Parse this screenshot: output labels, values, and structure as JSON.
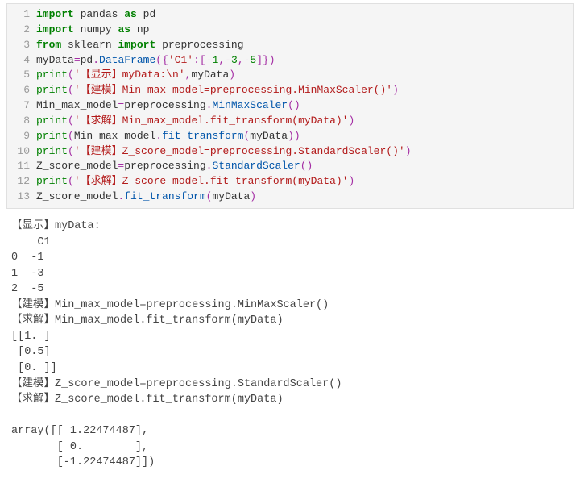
{
  "code": {
    "lines": [
      {
        "n": "1",
        "tokens": [
          [
            "kw",
            "import"
          ],
          [
            "sp",
            " "
          ],
          [
            "name",
            "pandas"
          ],
          [
            "sp",
            " "
          ],
          [
            "kw",
            "as"
          ],
          [
            "sp",
            " "
          ],
          [
            "name",
            "pd"
          ]
        ]
      },
      {
        "n": "2",
        "tokens": [
          [
            "kw",
            "import"
          ],
          [
            "sp",
            " "
          ],
          [
            "name",
            "numpy"
          ],
          [
            "sp",
            " "
          ],
          [
            "kw",
            "as"
          ],
          [
            "sp",
            " "
          ],
          [
            "name",
            "np"
          ]
        ]
      },
      {
        "n": "3",
        "tokens": [
          [
            "kw",
            "from"
          ],
          [
            "sp",
            " "
          ],
          [
            "name",
            "sklearn"
          ],
          [
            "sp",
            " "
          ],
          [
            "kw",
            "import"
          ],
          [
            "sp",
            " "
          ],
          [
            "name",
            "preprocessing"
          ]
        ]
      },
      {
        "n": "4",
        "tokens": [
          [
            "name",
            "myData"
          ],
          [
            "op",
            "="
          ],
          [
            "name",
            "pd"
          ],
          [
            "op",
            "."
          ],
          [
            "call",
            "DataFrame"
          ],
          [
            "op",
            "({"
          ],
          [
            "str",
            "'C1'"
          ],
          [
            "op",
            ":["
          ],
          [
            "op",
            "-"
          ],
          [
            "num",
            "1"
          ],
          [
            "op",
            ","
          ],
          [
            "op",
            "-"
          ],
          [
            "num",
            "3"
          ],
          [
            "op",
            ","
          ],
          [
            "op",
            "-"
          ],
          [
            "num",
            "5"
          ],
          [
            "op",
            "]})"
          ]
        ]
      },
      {
        "n": "5",
        "tokens": [
          [
            "builtin",
            "print"
          ],
          [
            "op",
            "("
          ],
          [
            "str",
            "'【显示】myData:\\n'"
          ],
          [
            "op",
            ","
          ],
          [
            "name",
            "myData"
          ],
          [
            "op",
            ")"
          ]
        ]
      },
      {
        "n": "6",
        "tokens": [
          [
            "builtin",
            "print"
          ],
          [
            "op",
            "("
          ],
          [
            "str",
            "'【建模】Min_max_model=preprocessing.MinMaxScaler()'"
          ],
          [
            "op",
            ")"
          ]
        ]
      },
      {
        "n": "7",
        "tokens": [
          [
            "name",
            "Min_max_model"
          ],
          [
            "op",
            "="
          ],
          [
            "name",
            "preprocessing"
          ],
          [
            "op",
            "."
          ],
          [
            "call",
            "MinMaxScaler"
          ],
          [
            "op",
            "()"
          ]
        ]
      },
      {
        "n": "8",
        "tokens": [
          [
            "builtin",
            "print"
          ],
          [
            "op",
            "("
          ],
          [
            "str",
            "'【求解】Min_max_model.fit_transform(myData)'"
          ],
          [
            "op",
            ")"
          ]
        ]
      },
      {
        "n": "9",
        "tokens": [
          [
            "builtin",
            "print"
          ],
          [
            "op",
            "("
          ],
          [
            "name",
            "Min_max_model"
          ],
          [
            "op",
            "."
          ],
          [
            "call",
            "fit_transform"
          ],
          [
            "op",
            "("
          ],
          [
            "name",
            "myData"
          ],
          [
            "op",
            "))"
          ]
        ]
      },
      {
        "n": "10",
        "tokens": [
          [
            "builtin",
            "print"
          ],
          [
            "op",
            "("
          ],
          [
            "str",
            "'【建模】Z_score_model=preprocessing.StandardScaler()'"
          ],
          [
            "op",
            ")"
          ]
        ]
      },
      {
        "n": "11",
        "tokens": [
          [
            "name",
            "Z_score_model"
          ],
          [
            "op",
            "="
          ],
          [
            "name",
            "preprocessing"
          ],
          [
            "op",
            "."
          ],
          [
            "call",
            "StandardScaler"
          ],
          [
            "op",
            "()"
          ]
        ]
      },
      {
        "n": "12",
        "tokens": [
          [
            "builtin",
            "print"
          ],
          [
            "op",
            "("
          ],
          [
            "str",
            "'【求解】Z_score_model.fit_transform(myData)'"
          ],
          [
            "op",
            ")"
          ]
        ]
      },
      {
        "n": "13",
        "tokens": [
          [
            "name",
            "Z_score_model"
          ],
          [
            "op",
            "."
          ],
          [
            "call",
            "fit_transform"
          ],
          [
            "op",
            "("
          ],
          [
            "name",
            "myData"
          ],
          [
            "op",
            ")"
          ]
        ]
      }
    ]
  },
  "output": "【显示】myData:\n    C1\n0  -1\n1  -3\n2  -5\n【建模】Min_max_model=preprocessing.MinMaxScaler()\n【求解】Min_max_model.fit_transform(myData)\n[[1. ]\n [0.5]\n [0. ]]\n【建模】Z_score_model=preprocessing.StandardScaler()\n【求解】Z_score_model.fit_transform(myData)\n\narray([[ 1.22474487],\n       [ 0.        ],\n       [-1.22474487]])"
}
